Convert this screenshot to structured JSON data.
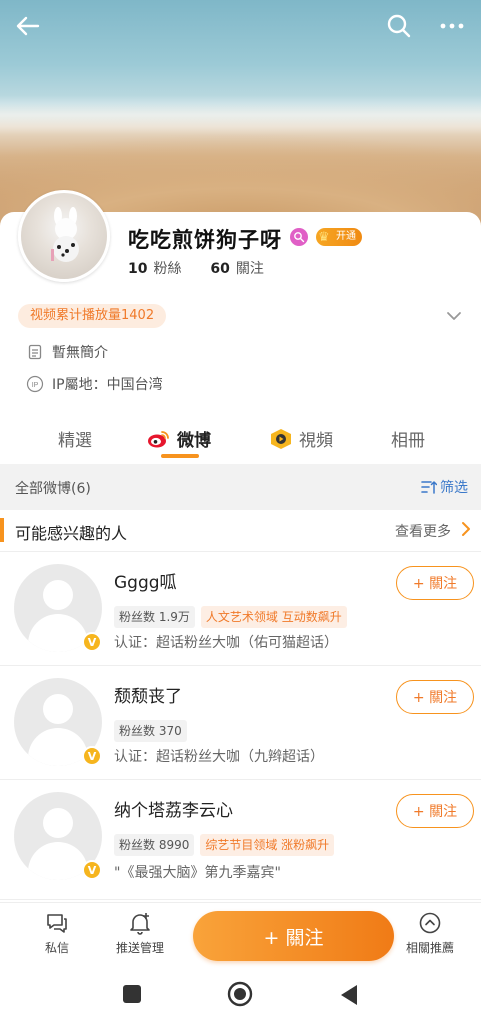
{
  "profile": {
    "name": "吃吃煎饼狗子呀",
    "vip_label": "开通",
    "fans_count": "10",
    "fans_label": "粉絲",
    "following_count": "60",
    "following_label": "關注",
    "play_tag": "视频累计播放量1402",
    "intro": "暫無簡介",
    "ip_location": "IP屬地：中国台湾"
  },
  "tabs": [
    {
      "label": "精選"
    },
    {
      "label": "微博"
    },
    {
      "label": "視頻"
    },
    {
      "label": "相冊"
    }
  ],
  "filterbar": {
    "all_label": "全部微博(6)",
    "filter_label": "筛选"
  },
  "recommend": {
    "title": "可能感兴趣的人",
    "more_label": "查看更多",
    "users": [
      {
        "name": "Gggg呱",
        "tags": [
          {
            "text": "粉丝数 1.9万",
            "style": "gray"
          },
          {
            "text": "人文艺术领域 互动数飙升",
            "style": "orange"
          }
        ],
        "desc": "认证：超话粉丝大咖（佑可猫超话）",
        "follow_label": "+ 關注"
      },
      {
        "name": "颓颓丧了",
        "tags": [
          {
            "text": "粉丝数 370",
            "style": "gray"
          }
        ],
        "desc": "认证：超话粉丝大咖（九辫超话）",
        "follow_label": "+ 關注"
      },
      {
        "name": "纳个塔荔李云心",
        "tags": [
          {
            "text": "粉丝数 8990",
            "style": "gray"
          },
          {
            "text": "综艺节目领域 涨粉飙升",
            "style": "orange"
          }
        ],
        "desc": "\"《最强大脑》第九季嘉宾\"",
        "follow_label": "+ 關注"
      }
    ]
  },
  "bottombar": {
    "message_label": "私信",
    "push_label": "推送管理",
    "follow_label": "+ 關注",
    "related_label": "相關推薦"
  },
  "colors": {
    "accent": "#f7931e",
    "link_blue": "#3a78c9"
  }
}
